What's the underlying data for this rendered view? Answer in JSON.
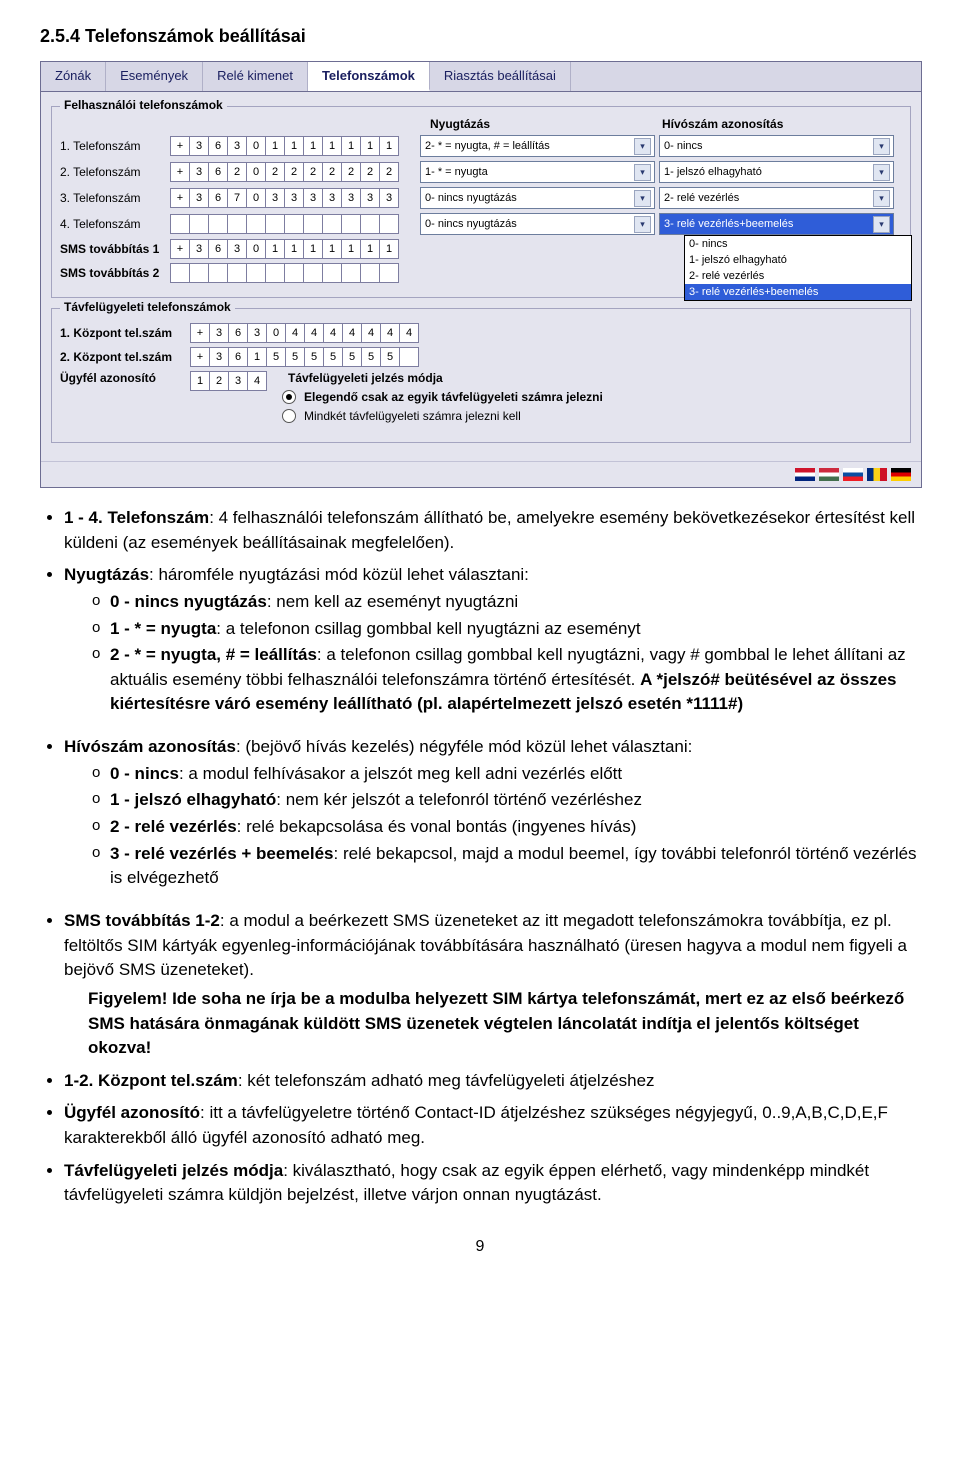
{
  "heading": "2.5.4  Telefonszámok beállításai",
  "tabs": [
    "Zónák",
    "Események",
    "Relé kimenet",
    "Telefonszámok",
    "Riasztás beállításai"
  ],
  "tab_active": 3,
  "fs_user_legend": "Felhasználói telefonszámok",
  "fs_remote_legend": "Távfelügyeleti telefonszámok",
  "hdr": {
    "ack": "Nyugtázás",
    "caller": "Hívószám azonosítás"
  },
  "rows": [
    {
      "lbl": "1. Telefonszám",
      "digits": [
        "+",
        "3",
        "6",
        "3",
        "0",
        "1",
        "1",
        "1",
        "1",
        "1",
        "1",
        "1"
      ],
      "ack": "2- * = nyugta, # = leállítás",
      "caller": "0- nincs"
    },
    {
      "lbl": "2. Telefonszám",
      "digits": [
        "+",
        "3",
        "6",
        "2",
        "0",
        "2",
        "2",
        "2",
        "2",
        "2",
        "2",
        "2"
      ],
      "ack": "1- * = nyugta",
      "caller": "1- jelszó elhagyható"
    },
    {
      "lbl": "3. Telefonszám",
      "digits": [
        "+",
        "3",
        "6",
        "7",
        "0",
        "3",
        "3",
        "3",
        "3",
        "3",
        "3",
        "3"
      ],
      "ack": "0- nincs nyugtázás",
      "caller": "2- relé vezérlés"
    },
    {
      "lbl": "4. Telefonszám",
      "digits": [
        "",
        "",
        "",
        "",
        "",
        "",
        "",
        "",
        "",
        "",
        "",
        ""
      ],
      "ack": "0- nincs nyugtázás",
      "caller": "3- relé vezérlés+beemelés",
      "dropdown": true
    }
  ],
  "sms1": {
    "lbl": "SMS továbbítás 1",
    "digits": [
      "+",
      "3",
      "6",
      "3",
      "0",
      "1",
      "1",
      "1",
      "1",
      "1",
      "1",
      "1"
    ]
  },
  "sms2": {
    "lbl": "SMS továbbítás 2",
    "digits": [
      "",
      "",
      "",
      "",
      "",
      "",
      "",
      "",
      "",
      "",
      "",
      ""
    ]
  },
  "dropdown_options": [
    "0- nincs",
    "1- jelszó elhagyható",
    "2- relé vezérlés",
    "3- relé vezérlés+beemelés"
  ],
  "dropdown_selected": 3,
  "kozpont1": {
    "lbl": "1. Központ tel.szám",
    "digits": [
      "+",
      "3",
      "6",
      "3",
      "0",
      "4",
      "4",
      "4",
      "4",
      "4",
      "4",
      "4"
    ]
  },
  "kozpont2": {
    "lbl": "2. Központ tel.szám",
    "digits": [
      "+",
      "3",
      "6",
      "1",
      "5",
      "5",
      "5",
      "5",
      "5",
      "5",
      "5",
      ""
    ]
  },
  "ugyfel": {
    "lbl": "Ügyfél azonosító",
    "digits": [
      "1",
      "2",
      "3",
      "4"
    ]
  },
  "mode_label": "Távfelügyeleti jelzés módja",
  "mode_opts": [
    "Elegendő csak az egyik távfelügyeleti számra jelezni",
    "Mindkét távfelügyeleti számra jelezni kell"
  ],
  "mode_selected": 0,
  "text": {
    "b1": "1 - 4. Telefonszám",
    "b1r": ": 4 felhasználói telefonszám állítható be, amelyekre esemény bekövetkezésekor értesítést kell küldeni (az események beállításainak megfelelően).",
    "b2": "Nyugtázás",
    "b2r": ": háromféle nyugtázási mód közül lehet választani:",
    "b2s": [
      "0 - nincs nyugtázás: nem kell az eseményt nyugtázni",
      "1 - * = nyugta: a telefonon csillag gombbal kell nyugtázni az eseményt",
      "2 - * = nyugta, # = leállítás: a telefonon csillag gombbal kell nyugtázni, vagy # gombbal le lehet állítani az aktuális esemény többi felhasználói telefonszámra történő értesítését. A *jelszó# beütésével az összes kiértesítésre váró esemény leállítható (pl. alapértelmezett jelszó esetén *1111#)"
    ],
    "b2s2b": "2 - * = nyugta, # = leállítás",
    "b2s2a": "A *jelszó# beütésével az összes kiértesítésre váró esemény leállítható (pl. alapértelmezett jelszó esetén *1111#)",
    "b3": "Hívószám azonosítás",
    "b3r": ": (bejövő hívás kezelés) négyféle mód közül lehet választani:",
    "b3s": [
      "0 - nincs: a modul felhívásakor a jelszót meg kell adni vezérlés előtt",
      "1 - jelszó elhagyható: nem kér jelszót a telefonról történő vezérléshez",
      "2 - relé vezérlés: relé bekapcsolása és vonal bontás (ingyenes hívás)",
      "3 - relé vezérlés + beemelés: relé bekapcsol, majd a modul beemel, így további telefonról történő vezérlés is elvégezhető"
    ],
    "b4": "SMS továbbítás 1-2",
    "b4r": ": a modul a beérkezett SMS üzeneteket az itt megadott telefonszámokra továbbítja, ez pl. feltöltős SIM kártyák egyenleg-információjának továbbítására használható (üresen hagyva a modul nem figyeli a bejövő SMS üzeneteket).",
    "b4w": "Figyelem! Ide soha ne írja be a modulba helyezett SIM kártya telefonszámát, mert ez az első beérkező SMS hatására önmagának küldött SMS üzenetek végtelen láncolatát indítja el jelentős költséget okozva!",
    "b5": "1-2. Központ tel.szám",
    "b5r": ": két telefonszám adható meg távfelügyeleti átjelzéshez",
    "b6": "Ügyfél azonosító",
    "b6r": ": itt a távfelügyeletre történő Contact-ID átjelzéshez szükséges négyjegyű, 0..9,A,B,C,D,E,F karakterekből álló ügyfél azonosító adható meg.",
    "b7": "Távfelügyeleti jelzés módja",
    "b7r": ": kiválasztható, hogy csak az egyik éppen elérhető, vagy mindenképp mindkét távfelügyeleti számra küldjön bejelzést, illetve várjon onnan nyugtázást."
  },
  "pagenum": "9"
}
